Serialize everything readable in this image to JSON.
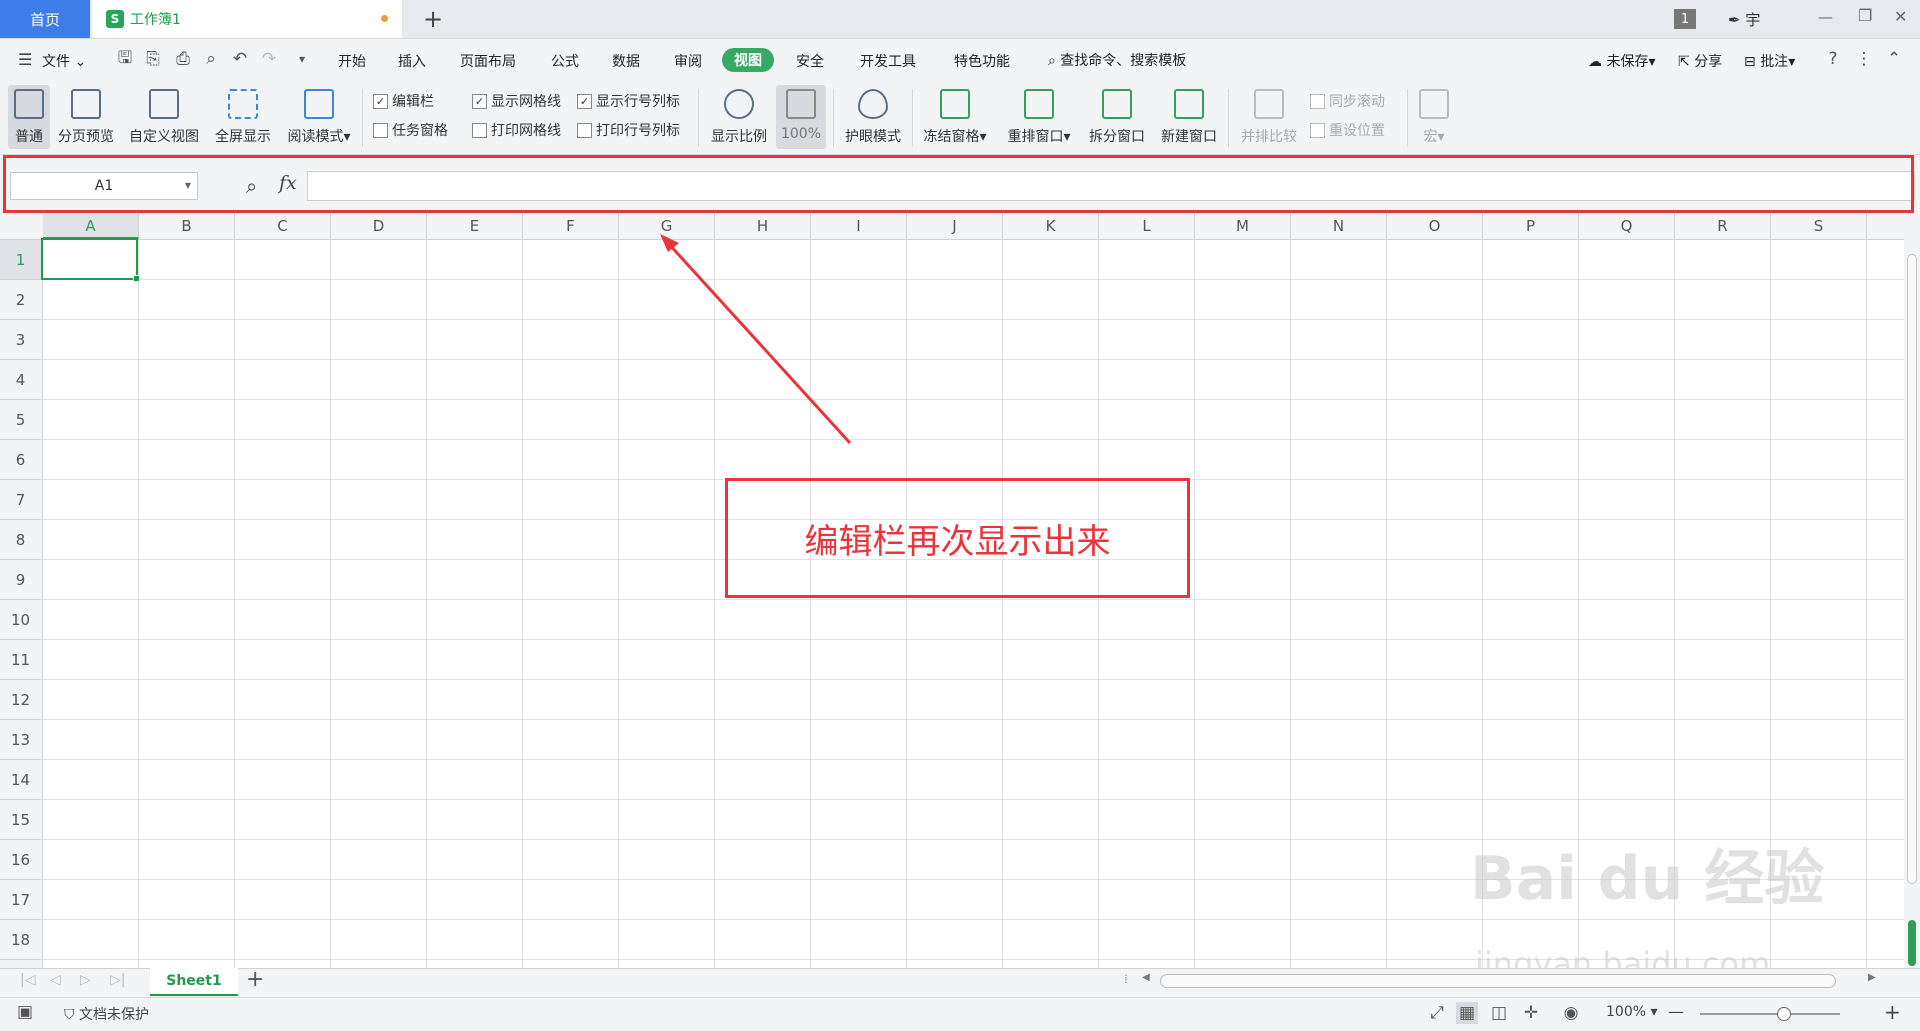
{
  "titlebar": {
    "home_tab": "首页",
    "doc_tab": "工作簿1",
    "doc_icon": "S",
    "page_badge": "1",
    "user": "宇",
    "window_controls": [
      "—",
      "❐",
      "✕"
    ]
  },
  "menubar": {
    "file": "文件",
    "items": [
      "开始",
      "插入",
      "页面布局",
      "公式",
      "数据",
      "审阅",
      "视图",
      "安全",
      "开发工具",
      "特色功能"
    ],
    "active": "视图",
    "search": "查找命令、搜索模板",
    "unsaved": "未保存",
    "share": "分享",
    "comment": "批注"
  },
  "ribbon": {
    "normal": "普通",
    "page_break_preview": "分页预览",
    "custom_view": "自定义视图",
    "full_screen": "全屏显示",
    "reading_mode": "阅读模式",
    "chk_editbar": "编辑栏",
    "chk_task_pane": "任务窗格",
    "chk_show_grid": "显示网格线",
    "chk_print_grid": "打印网格线",
    "chk_show_headers": "显示行号列标",
    "chk_print_headers": "打印行号列标",
    "zoom": "显示比例",
    "zoom_100": "100%",
    "eye_mode": "护眼模式",
    "freeze": "冻结窗格",
    "rearrange": "重排窗口",
    "split": "拆分窗口",
    "new_window": "新建窗口",
    "side_by_side": "并排比较",
    "sync_scroll": "同步滚动",
    "reset_position": "重设位置",
    "macro": "宏"
  },
  "formula": {
    "namebox": "A1",
    "fx": "fx",
    "value": ""
  },
  "grid": {
    "columns": [
      "A",
      "B",
      "C",
      "D",
      "E",
      "F",
      "G",
      "H",
      "I",
      "J",
      "K",
      "L",
      "M",
      "N",
      "O",
      "P",
      "Q",
      "R",
      "S"
    ],
    "rows": [
      "1",
      "2",
      "3",
      "4",
      "5",
      "6",
      "7",
      "8",
      "9",
      "10",
      "11",
      "12",
      "13",
      "14",
      "15",
      "16",
      "17",
      "18"
    ],
    "selected_cell": "A1"
  },
  "annotation": {
    "text": "编辑栏再次显示出来",
    "color": "#e8343b"
  },
  "sheets": {
    "tabs": [
      "Sheet1"
    ],
    "add": "+"
  },
  "status": {
    "protect": "文档未保护",
    "zoom": "100%",
    "minus": "—",
    "plus": "+"
  },
  "watermark": {
    "main": "Bai du 经验",
    "url": "jingyan.baidu.com"
  },
  "colors": {
    "accent_green": "#36a965",
    "home_blue": "#3d7de7",
    "annotation_red": "#e8343b"
  }
}
